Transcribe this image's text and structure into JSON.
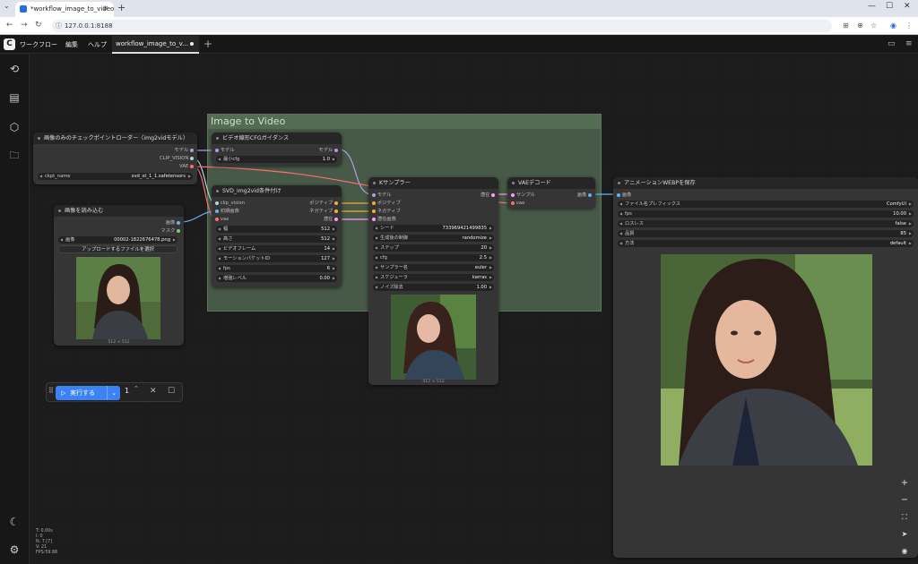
{
  "browser": {
    "tab_title": "*workflow_image_to_video",
    "tab_close": "✕",
    "new_tab": "+",
    "url": "127.0.0.1:8188",
    "nav_back": "←",
    "nav_forward": "→",
    "nav_reload": "↻",
    "site_info": "ⓘ",
    "translate_icon": "⊞",
    "zoom_icon": "⊕",
    "star_icon": "☆",
    "profile_icon": "◉",
    "menu_icon": "⋮",
    "minimize": "—",
    "maximize": "☐",
    "close": "✕",
    "tab_dropdown": "⌄"
  },
  "menubar": {
    "logo": "C",
    "items": [
      "ワークフロー",
      "編集",
      "ヘルプ"
    ],
    "workflow_tab": "workflow_image_to_v...",
    "add_tab": "+",
    "panel_icon": "▭",
    "menu_icon": "≡"
  },
  "sidebar": {
    "history_icon": "⟲",
    "library_icon": "▤",
    "models_icon": "⬡",
    "folder_icon": "🗀",
    "theme_icon": "☾",
    "settings_icon": "⚙"
  },
  "group": {
    "title": "Image to Video"
  },
  "nodes": {
    "checkpoint": {
      "title": "画像のみのチェックポイントローダー（img2vidモデル）",
      "out_model": "モデル",
      "out_clip_vision": "CLIP_VISION",
      "out_vae": "VAE",
      "ckpt_label": "ckpt_name",
      "ckpt_value": "svd_xt_1_1.safetensors"
    },
    "load_image": {
      "title": "画像を読み込む",
      "out_image": "画像",
      "out_mask": "マスク",
      "image_label": "画像",
      "image_value": "00002-1822676478.png",
      "upload_button": "アップロードするファイルを選択",
      "caption": "512 × 512"
    },
    "cfg_guidance": {
      "title": "ビデオ線形CFGガイダンス",
      "in_model": "モデル",
      "out_model": "モデル",
      "min_cfg_label": "最小cfg",
      "min_cfg_value": "1.0"
    },
    "svd_cond": {
      "title": "SVD_img2vid条件付け",
      "in_clip_vision": "clip_vision",
      "in_init_image": "初期画像",
      "in_vae": "vae",
      "out_positive": "ポジティブ",
      "out_negative": "ネガティブ",
      "out_latent": "潜在",
      "widgets": [
        {
          "label": "幅",
          "value": "512"
        },
        {
          "label": "高さ",
          "value": "512"
        },
        {
          "label": "ビデオフレーム",
          "value": "14"
        },
        {
          "label": "モーションバケットID",
          "value": "127"
        },
        {
          "label": "fps",
          "value": "6"
        },
        {
          "label": "増強レベル",
          "value": "0.00"
        }
      ]
    },
    "ksampler": {
      "title": "Kサンプラー",
      "in_model": "モデル",
      "in_positive": "ポジティブ",
      "in_negative": "ネガティブ",
      "in_latent": "潜在画像",
      "out_latent": "潜在",
      "widgets": [
        {
          "label": "シード",
          "value": "733969421499835"
        },
        {
          "label": "生成後の制御",
          "value": "randomize"
        },
        {
          "label": "ステップ",
          "value": "20"
        },
        {
          "label": "cfg",
          "value": "2.5"
        },
        {
          "label": "サンプラー名",
          "value": "euler"
        },
        {
          "label": "スケジューラ",
          "value": "karras"
        },
        {
          "label": "ノイズ除去",
          "value": "1.00"
        }
      ],
      "caption": "512 × 512"
    },
    "vae_decode": {
      "title": "VAEデコード",
      "in_samples": "サンプル",
      "in_vae": "vae",
      "out_image": "画像"
    },
    "save_webp": {
      "title": "アニメーションWEBPを保存",
      "in_images": "画像",
      "widgets": [
        {
          "label": "ファイル名プレフィックス",
          "value": "ComfyUI"
        },
        {
          "label": "fps",
          "value": "10.00"
        },
        {
          "label": "ロスレス",
          "value": "false"
        },
        {
          "label": "品質",
          "value": "85"
        },
        {
          "label": "方法",
          "value": "default"
        }
      ]
    }
  },
  "runbar": {
    "drag_icon": "⠿",
    "run_label": "実行する",
    "play_icon": "▷",
    "dropdown_icon": "⌄",
    "count": "1",
    "stepper_icon": "⌃",
    "cancel_icon": "✕",
    "stop_icon": "☐"
  },
  "stats": [
    "T: 0.00s",
    "I: 0",
    "N: 7 [7]",
    "V: 21",
    "FPS:59.88"
  ],
  "zoom": {
    "zoom_in": "+",
    "zoom_out": "−",
    "fit": "⛶",
    "locate": "➤",
    "visibility": "◉"
  },
  "link_colors": {
    "model": "#b39ddb",
    "clip_vision": "#a8dadc",
    "vae": "#ff6e6e",
    "image": "#64b5f6",
    "conditioning": "#ffa931",
    "latent": "#ff9cf9"
  }
}
